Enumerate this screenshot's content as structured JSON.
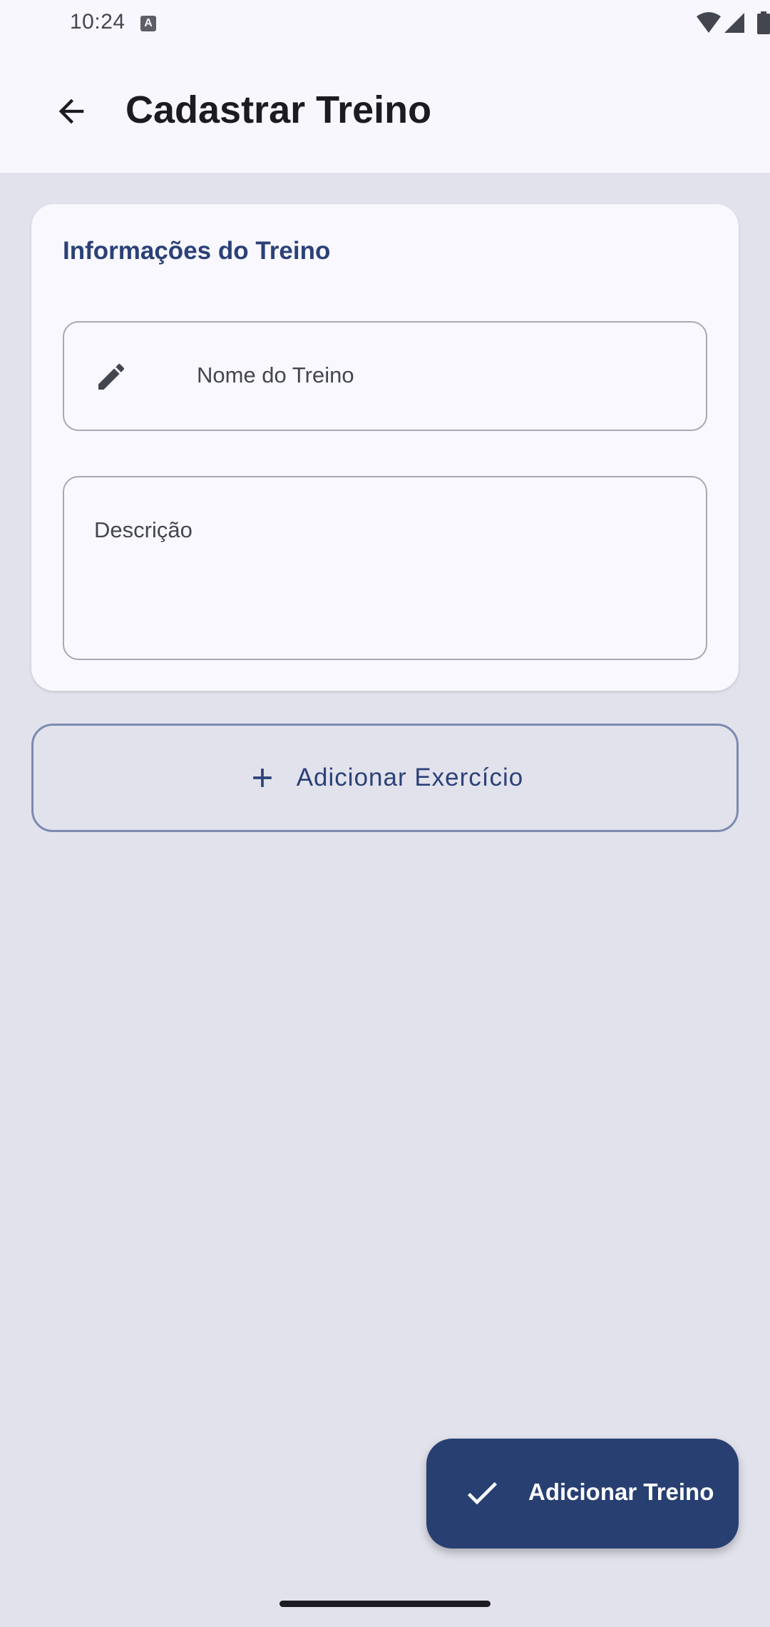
{
  "status_bar": {
    "time": "10:24",
    "notification_icon": "a-icon",
    "wifi_icon": "wifi-icon",
    "signal_icon": "signal-icon",
    "battery_icon": "battery-icon"
  },
  "app_bar": {
    "back_icon": "arrow-back-icon",
    "title": "Cadastrar Treino"
  },
  "card": {
    "title": "Informações do Treino",
    "name_field": {
      "icon": "pencil-icon",
      "placeholder": "Nome do Treino",
      "value": ""
    },
    "description_field": {
      "placeholder": "Descrição",
      "value": ""
    }
  },
  "add_exercise": {
    "icon": "plus-icon",
    "label": "Adicionar Exercício"
  },
  "fab": {
    "icon": "check-icon",
    "label": "Adicionar Treino"
  },
  "colors": {
    "background": "#e2e2ec",
    "surface": "#f8f8fe",
    "accent": "#2b4177",
    "fab": "#283f72",
    "outline": "#a7a9b2"
  }
}
